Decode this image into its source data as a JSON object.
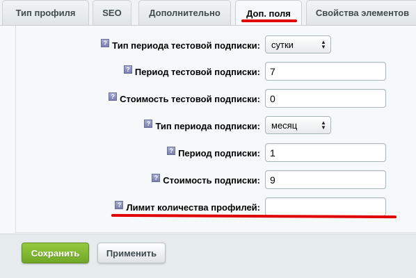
{
  "tabs": [
    {
      "label": "Тип профиля",
      "active": false
    },
    {
      "label": "SEO",
      "active": false
    },
    {
      "label": "Дополнительно",
      "active": false
    },
    {
      "label": "Доп. поля",
      "active": true
    },
    {
      "label": "Свойства элементов",
      "active": false
    }
  ],
  "help_icon_glyph": "?",
  "fields": {
    "trial_period_type": {
      "label": "Тип периода тестовой подписки:",
      "value": "сутки"
    },
    "trial_period": {
      "label": "Период тестовой подписки:",
      "value": "7"
    },
    "trial_cost": {
      "label": "Стоимость тестовой подписки:",
      "value": "0"
    },
    "period_type": {
      "label": "Тип периода подписки:",
      "value": "месяц"
    },
    "period": {
      "label": "Период подписки:",
      "value": "1"
    },
    "cost": {
      "label": "Стоимость подписки:",
      "value": "9"
    },
    "profile_limit": {
      "label": "Лимит количества профилей:",
      "value": ""
    }
  },
  "buttons": {
    "save": "Сохранить",
    "apply": "Применить"
  },
  "colors": {
    "highlight_red": "#e00000",
    "save_green": "#7bb32e",
    "help_icon": "#8a8fc0"
  }
}
